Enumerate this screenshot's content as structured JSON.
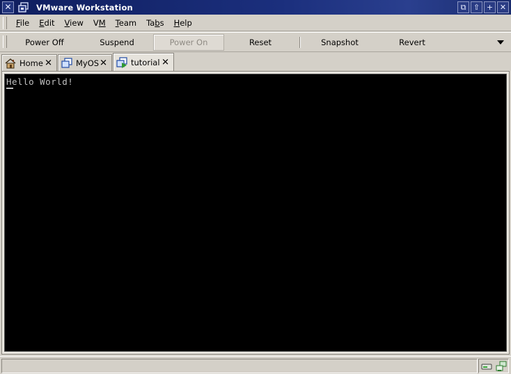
{
  "window": {
    "title": "VMware Workstation",
    "close_glyph": "✕",
    "controls": [
      "⧉",
      "⇧",
      "+",
      "✕"
    ]
  },
  "menu": {
    "items": [
      {
        "label": "File",
        "mnemonic": "F"
      },
      {
        "label": "Edit",
        "mnemonic": "E"
      },
      {
        "label": "View",
        "mnemonic": "V"
      },
      {
        "label": "VM",
        "mnemonic": "M"
      },
      {
        "label": "Team",
        "mnemonic": "T"
      },
      {
        "label": "Tabs",
        "mnemonic": "b"
      },
      {
        "label": "Help",
        "mnemonic": "H"
      }
    ]
  },
  "toolbar": {
    "power_off": "Power Off",
    "suspend": "Suspend",
    "power_on": "Power On",
    "reset": "Reset",
    "snapshot": "Snapshot",
    "revert": "Revert"
  },
  "tabs": [
    {
      "label": "Home",
      "icon": "home-icon",
      "close": "✕",
      "active": false
    },
    {
      "label": "MyOS",
      "icon": "vm-icon",
      "close": "✕",
      "active": false
    },
    {
      "label": "tutorial",
      "icon": "vm-running-icon",
      "close": "✕",
      "active": true
    }
  ],
  "console": {
    "text": "Hello World!"
  },
  "status": {
    "icons": [
      "hard-disk-icon",
      "network-icon"
    ]
  },
  "colors": {
    "titlebar": "#1b2f7d",
    "chrome": "#d4d0c8",
    "console_bg": "#000000",
    "console_fg": "#c0c0c0"
  }
}
